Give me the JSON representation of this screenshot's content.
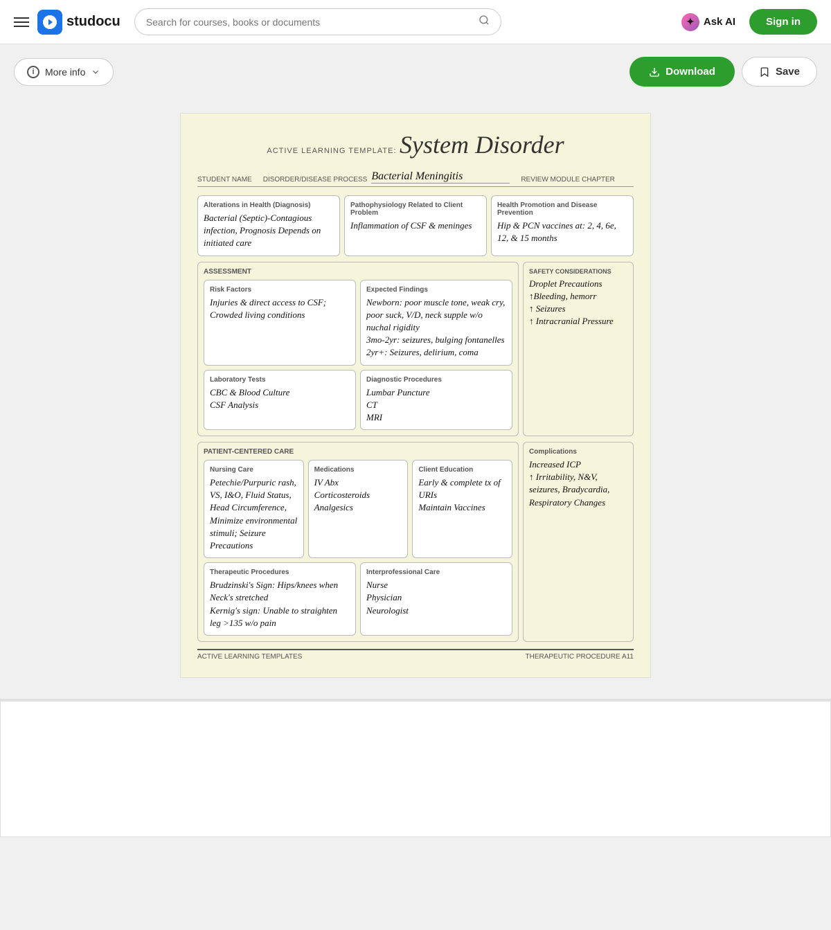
{
  "header": {
    "menu_label": "Menu",
    "logo_text": "studocu",
    "search_placeholder": "Search for courses, books or documents",
    "ask_ai_label": "Ask AI",
    "sign_in_label": "Sign in"
  },
  "toolbar": {
    "more_info_label": "More info",
    "download_label": "Download",
    "save_label": "Save"
  },
  "document": {
    "template_label": "ACTIVE LEARNING TEMPLATE:",
    "template_title": "System Disorder",
    "student_name_label": "STUDENT NAME",
    "disorder_label": "DISORDER/DISEASE PROCESS",
    "disorder_value": "Bacterial Meningitis",
    "review_module_label": "REVIEW MODULE CHAPTER",
    "boxes": {
      "alterations": {
        "title": "Alterations in Health (Diagnosis)",
        "content": "Bacterial (Septic)-Contagious infection, Prognosis Depends on initiated care"
      },
      "pathophysiology": {
        "title": "Pathophysiology Related to Client Problem",
        "content": "Inflammation of CSF & meninges"
      },
      "health_promotion": {
        "title": "Health Promotion and Disease Prevention",
        "content": "Hip & PCN vaccines at: 2, 4, 6e, 12, & 15 months"
      }
    },
    "assessment_label": "ASSESSMENT",
    "safety_label": "SAFETY CONSIDERATIONS",
    "safety_content": "Droplet Precautions\n↑Bleeding, hemorr\n↑ Seizures\n↑ Intracranial Pressure",
    "risk_factors": {
      "title": "Risk Factors",
      "content": "Injuries & direct access to CSF; Crowded living conditions"
    },
    "expected_findings": {
      "title": "Expected Findings",
      "content": "Newborn: poor muscle tone, weak cry, poor suck, V/D, neck supple w/o nuchal rigidity\n3mo-2yr: seizures, bulging fontanelles\n2yr+: Seizures, delirium, coma"
    },
    "lab_tests": {
      "title": "Laboratory Tests",
      "content": "CBC & Blood Culture\nCSF Analysis"
    },
    "diagnostic": {
      "title": "Diagnostic Procedures",
      "content": "Lumbar Puncture\nCT\nMRI"
    },
    "pcc_label": "PATIENT-CENTERED CARE",
    "nursing_care": {
      "title": "Nursing Care",
      "content": "Petechie/Purpuric rash, VS, I&O, Fluid Status, Head Circumference, Minimize environmental stimuli; Seizure Precautions"
    },
    "medications": {
      "title": "Medications",
      "content": "IV Abx\nCorticosteroids\nAnalgesics"
    },
    "client_education": {
      "title": "Client Education",
      "content": "Early & complete tx of URIs\nMaintain Vaccines"
    },
    "therapeutic": {
      "title": "Therapeutic Procedures",
      "content": "Brudzinski's Sign: Hips/knees when Neck's stretched\nKernig's sign: Unable to straighten leg >135 w/o pain"
    },
    "interprofessional": {
      "title": "Interprofessional Care",
      "content": "Nurse\nPhysician\nNeurologist"
    },
    "complications": {
      "title": "Complications",
      "content": "Increased ICP\n↑ Irritability, N&V, seizures, Bradycardia, Respiratory Changes"
    },
    "footer_left": "ACTIVE LEARNING TEMPLATES",
    "footer_right": "THERAPEUTIC PROCEDURE   A11"
  }
}
